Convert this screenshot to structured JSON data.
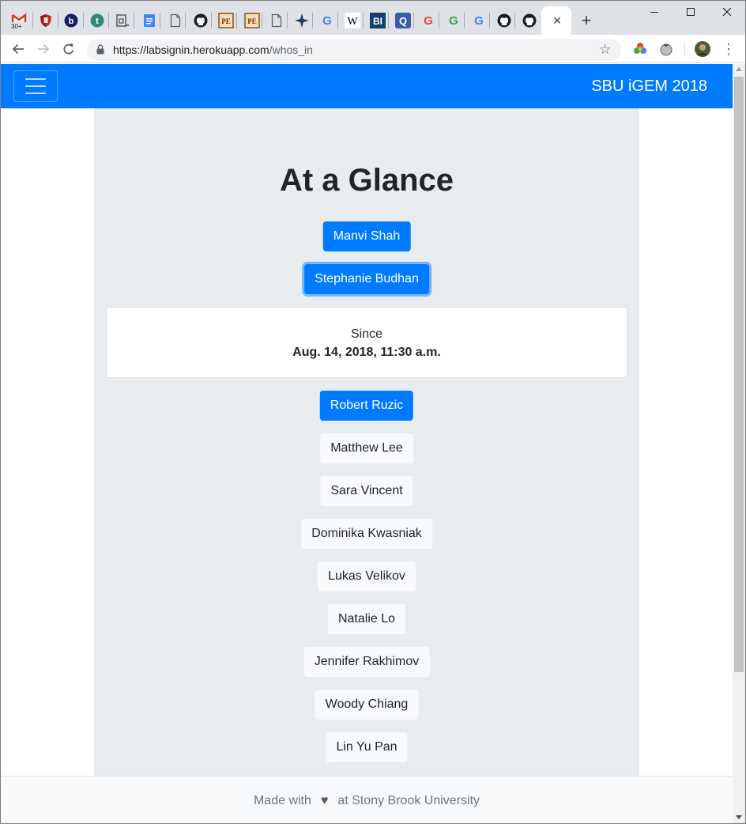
{
  "browser": {
    "tabs": [
      {
        "icon": "gmail-icon",
        "badge": "30+"
      },
      {
        "icon": "shield-icon"
      },
      {
        "icon": "b-circle-icon",
        "glyph": "b"
      },
      {
        "icon": "t-circle-icon",
        "glyph": "t"
      },
      {
        "icon": "classroom-icon"
      },
      {
        "icon": "google-docs-icon"
      },
      {
        "icon": "blank-page-icon"
      },
      {
        "icon": "github-icon"
      },
      {
        "icon": "pe-icon",
        "glyph": "PE"
      },
      {
        "icon": "pe-icon",
        "glyph": "PE"
      },
      {
        "icon": "blank-page-icon"
      },
      {
        "icon": "star-sparkle-icon"
      },
      {
        "icon": "google-icon",
        "glyph": "G"
      },
      {
        "icon": "wikipedia-icon",
        "glyph": "W"
      },
      {
        "icon": "bi-icon",
        "glyph": "BI"
      },
      {
        "icon": "quizlet-icon",
        "glyph": "Q"
      },
      {
        "icon": "google-icon",
        "glyph": "G"
      },
      {
        "icon": "google-icon",
        "glyph": "G"
      },
      {
        "icon": "google-icon",
        "glyph": "G"
      },
      {
        "icon": "github-icon"
      },
      {
        "icon": "github-icon"
      }
    ],
    "close_tab_glyph": "×",
    "new_tab_glyph": "+",
    "url_host": "https://labsignin.herokuapp.com",
    "url_path": "/whos_in",
    "star_glyph": "☆",
    "menu_glyph": "⋮"
  },
  "navbar": {
    "brand": "SBU iGEM 2018"
  },
  "page": {
    "title": "At a Glance",
    "people": [
      {
        "name": "Manvi Shah",
        "style": "primary"
      },
      {
        "name": "Stephanie Budhan",
        "style": "primary-focus"
      },
      {
        "name": "Robert Ruzic",
        "style": "primary"
      },
      {
        "name": "Matthew Lee",
        "style": "light"
      },
      {
        "name": "Sara Vincent",
        "style": "light"
      },
      {
        "name": "Dominika Kwasniak",
        "style": "light"
      },
      {
        "name": "Lukas Velikov",
        "style": "light"
      },
      {
        "name": "Natalie Lo",
        "style": "light"
      },
      {
        "name": "Jennifer Rakhimov",
        "style": "light"
      },
      {
        "name": "Woody Chiang",
        "style": "light"
      },
      {
        "name": "Lin Yu Pan",
        "style": "light"
      }
    ],
    "detail_card": {
      "label": "Since",
      "time": "Aug. 14, 2018, 11:30 a.m."
    }
  },
  "footer": {
    "before": "Made with",
    "heart": "♥",
    "after": "at Stony Brook University"
  },
  "colors": {
    "primary": "#007bff",
    "light_button": "#f8f9fa",
    "jumbotron": "#e9ecef",
    "tab_strip": "#dee1e6"
  }
}
